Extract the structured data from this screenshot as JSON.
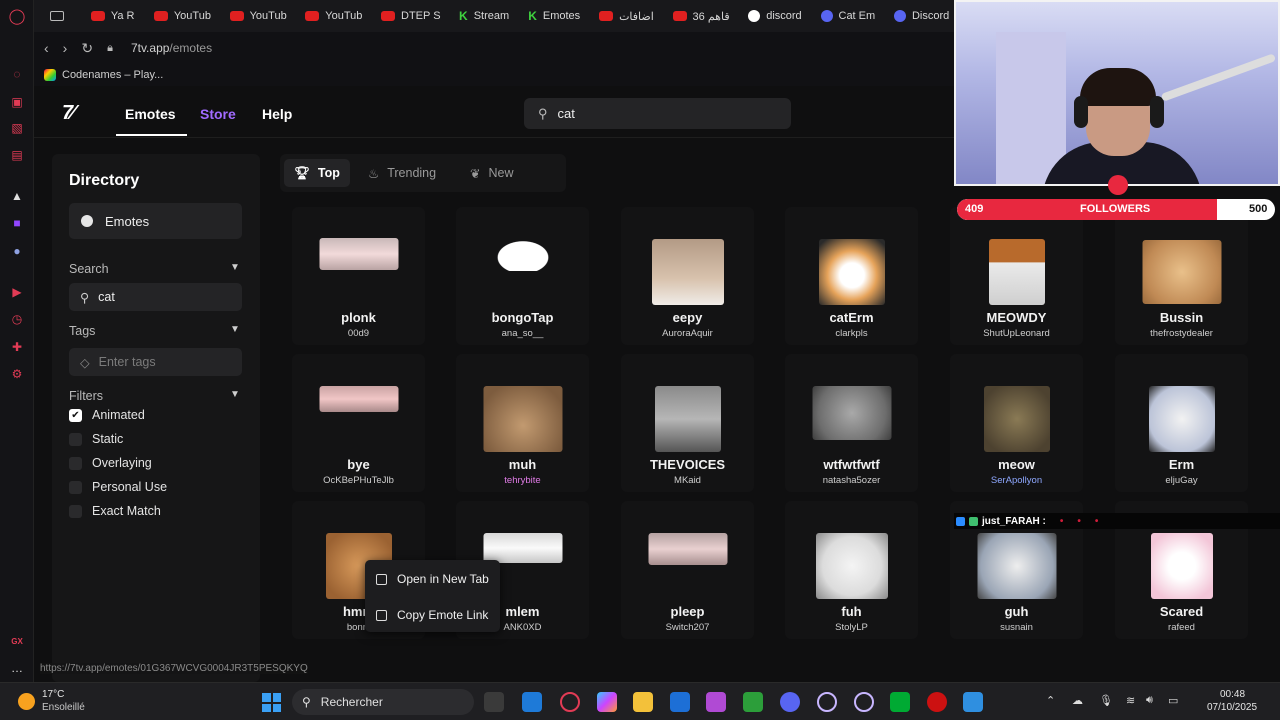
{
  "browser": {
    "tabs": [
      {
        "label": "",
        "icon": "camera-icon"
      },
      {
        "label": "Ya R",
        "icon": "youtube-icon"
      },
      {
        "label": "YouTub",
        "icon": "youtube-icon"
      },
      {
        "label": "YouTub",
        "icon": "youtube-icon"
      },
      {
        "label": "YouTub",
        "icon": "youtube-icon"
      },
      {
        "label": "DTEP S",
        "icon": "youtube-icon"
      },
      {
        "label": "Stream",
        "icon": "kick-icon"
      },
      {
        "label": "Emotes",
        "icon": "kick-icon"
      },
      {
        "label": "اضافات",
        "icon": "youtube-icon"
      },
      {
        "label": "36 قاهم",
        "icon": "youtube-icon"
      },
      {
        "label": "discord",
        "icon": "google-icon"
      },
      {
        "label": "Cat Em",
        "icon": "discord-icon"
      },
      {
        "label": "Discord",
        "icon": "discord-icon"
      }
    ],
    "url_host": "7tv.app",
    "url_path": "/emotes",
    "bookmark": "Codenames – Play...",
    "status_url": "https://7tv.app/emotes/01G367WCVG0004JR3T5PESQKYQ"
  },
  "site": {
    "logo": "7",
    "nav": {
      "emotes": "Emotes",
      "store": "Store",
      "help": "Help"
    },
    "search_value": "cat"
  },
  "directory": {
    "title": "Directory",
    "emotes_button": "Emotes",
    "search_label": "Search",
    "search_value": "cat",
    "tags_label": "Tags",
    "tags_placeholder": "Enter tags",
    "filters_label": "Filters",
    "filters": [
      {
        "label": "Animated",
        "checked": true
      },
      {
        "label": "Static",
        "checked": false
      },
      {
        "label": "Overlaying",
        "checked": false
      },
      {
        "label": "Personal Use",
        "checked": false
      },
      {
        "label": "Exact Match",
        "checked": false
      }
    ]
  },
  "sort": {
    "top": "Top",
    "trending": "Trending",
    "new": "New"
  },
  "emotes": [
    {
      "name": "plonk",
      "owner": "00d9"
    },
    {
      "name": "bongoTap",
      "owner": "ana_so__"
    },
    {
      "name": "eepy",
      "owner": "AuroraAquir"
    },
    {
      "name": "catErm",
      "owner": "clarkpls"
    },
    {
      "name": "MEOWDY",
      "owner": "ShutUpLeonard"
    },
    {
      "name": "Bussin",
      "owner": "thefrostydealer"
    },
    {
      "name": "bye",
      "owner": "OcKBePHuTeJlb"
    },
    {
      "name": "muh",
      "owner": "tehrybite"
    },
    {
      "name": "THEVOICES",
      "owner": "MKaid"
    },
    {
      "name": "wtfwtfwtf",
      "owner": "natasha5ozer"
    },
    {
      "name": "meow",
      "owner": "SerApollyon"
    },
    {
      "name": "Erm",
      "owner": "eljuGay"
    },
    {
      "name": "hmm",
      "owner": "bonni"
    },
    {
      "name": "mlem",
      "owner": "ANK0XD"
    },
    {
      "name": "pleep",
      "owner": "Switch207"
    },
    {
      "name": "fuh",
      "owner": "StolyLP"
    },
    {
      "name": "guh",
      "owner": "susnain"
    },
    {
      "name": "Scared",
      "owner": "rafeed"
    }
  ],
  "context_menu": {
    "open_new_tab": "Open in New Tab",
    "copy_link": "Copy Emote Link"
  },
  "overlay": {
    "followers_label": "FOLLOWERS",
    "followers_current": "409",
    "followers_goal": "500",
    "followers_progress": 0.818,
    "chat_user": "just_FARAH :"
  },
  "taskbar": {
    "temperature": "17°C",
    "weather": "Ensoleillé",
    "search_placeholder": "Rechercher",
    "time": "00:48",
    "date": "07/10/2025"
  },
  "colors": {
    "accent": "#a16bff",
    "follower_red": "#e8283f",
    "page_bg": "#0f0f10"
  }
}
